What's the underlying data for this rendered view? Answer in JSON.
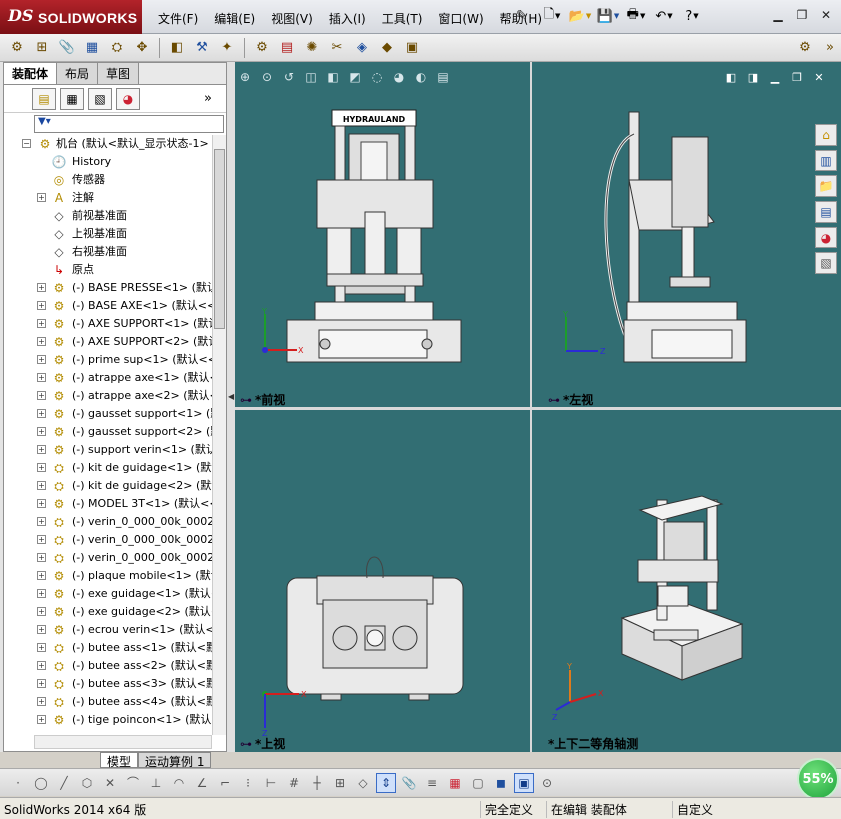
{
  "app": {
    "ds": "DS",
    "brand": "SOLIDWORKS"
  },
  "menu": [
    "文件(F)",
    "编辑(E)",
    "视图(V)",
    "插入(I)",
    "工具(T)",
    "窗口(W)",
    "帮助(H)"
  ],
  "feature_manager": {
    "tabs": [
      "装配体",
      "布局",
      "草图"
    ],
    "root": "机台 (默认<默认_显示状态-1>",
    "items": [
      {
        "label": "History",
        "icon": "history-icon",
        "expander": ""
      },
      {
        "label": "传感器",
        "icon": "sensor-icon",
        "expander": ""
      },
      {
        "label": "注解",
        "icon": "annotation-icon",
        "expander": "+"
      },
      {
        "label": "前视基准面",
        "icon": "plane-icon",
        "expander": ""
      },
      {
        "label": "上视基准面",
        "icon": "plane-icon",
        "expander": ""
      },
      {
        "label": "右视基准面",
        "icon": "plane-icon",
        "expander": ""
      },
      {
        "label": "原点",
        "icon": "origin-icon",
        "expander": ""
      },
      {
        "label": "(-) BASE PRESSE<1> (默认<",
        "icon": "part-icon",
        "expander": "+"
      },
      {
        "label": "(-) BASE AXE<1> (默认<<默",
        "icon": "part-icon",
        "expander": "+"
      },
      {
        "label": "(-) AXE SUPPORT<1> (默认",
        "icon": "part-icon",
        "expander": "+"
      },
      {
        "label": "(-) AXE SUPPORT<2> (默认",
        "icon": "part-icon",
        "expander": "+"
      },
      {
        "label": "(-) prime sup<1> (默认<<默",
        "icon": "part-icon",
        "expander": "+"
      },
      {
        "label": "(-) atrappe axe<1> (默认<<",
        "icon": "part-icon",
        "expander": "+"
      },
      {
        "label": "(-) atrappe axe<2> (默认<<",
        "icon": "part-icon",
        "expander": "+"
      },
      {
        "label": "(-) gausset support<1> (默",
        "icon": "part-icon",
        "expander": "+"
      },
      {
        "label": "(-) gausset support<2> (默认",
        "icon": "part-icon",
        "expander": "+"
      },
      {
        "label": "(-) support verin<1> (默认",
        "icon": "part-icon",
        "expander": "+"
      },
      {
        "label": "(-) kit de guidage<1> (默认",
        "icon": "assembly-icon",
        "expander": "+"
      },
      {
        "label": "(-) kit de guidage<2> (默认",
        "icon": "assembly-icon",
        "expander": "+"
      },
      {
        "label": "(-) MODEL 3T<1> (默认<<默",
        "icon": "part-icon",
        "expander": "+"
      },
      {
        "label": "(-) verin_0_000_00k_0002_1",
        "icon": "assembly-icon",
        "expander": "+"
      },
      {
        "label": "(-) verin_0_000_00k_0002_1",
        "icon": "assembly-icon",
        "expander": "+"
      },
      {
        "label": "(-) verin_0_000_00k_0002_1",
        "icon": "assembly-icon",
        "expander": "+"
      },
      {
        "label": "(-) plaque mobile<1> (默认",
        "icon": "part-icon",
        "expander": "+"
      },
      {
        "label": "(-) exe guidage<1> (默认<",
        "icon": "part-icon",
        "expander": "+"
      },
      {
        "label": "(-) exe guidage<2> (默认<",
        "icon": "part-icon",
        "expander": "+"
      },
      {
        "label": "(-) ecrou verin<1> (默认<<",
        "icon": "part-icon",
        "expander": "+"
      },
      {
        "label": "(-) butee ass<1> (默认<默认",
        "icon": "assembly-icon",
        "expander": "+"
      },
      {
        "label": "(-) butee ass<2> (默认<默认",
        "icon": "assembly-icon",
        "expander": "+"
      },
      {
        "label": "(-) butee ass<3> (默认<默认",
        "icon": "assembly-icon",
        "expander": "+"
      },
      {
        "label": "(-) butee ass<4> (默认<默认",
        "icon": "assembly-icon",
        "expander": "+"
      },
      {
        "label": "(-) tige poincon<1> (默认<<",
        "icon": "part-icon",
        "expander": "+"
      }
    ],
    "bottom_tabs": [
      "模型",
      "运动算例 1"
    ]
  },
  "viewports": {
    "front": "*前视",
    "left": "*左视",
    "top": "*上视",
    "iso": "*上下二等角轴测"
  },
  "nameplate": "HYDRAULAND",
  "axes": {
    "x": "X",
    "y": "Y",
    "z": "Z"
  },
  "progress": {
    "label": "55%",
    "value": 55
  },
  "status": {
    "product": "SolidWorks 2014 x64 版",
    "defined": "完全定义",
    "editing": "在编辑 装配体",
    "units": "自定义"
  },
  "colors": {
    "viewport_bg": "#326e73",
    "logo_red": "#a31c22",
    "progress_green": "#27b040"
  }
}
